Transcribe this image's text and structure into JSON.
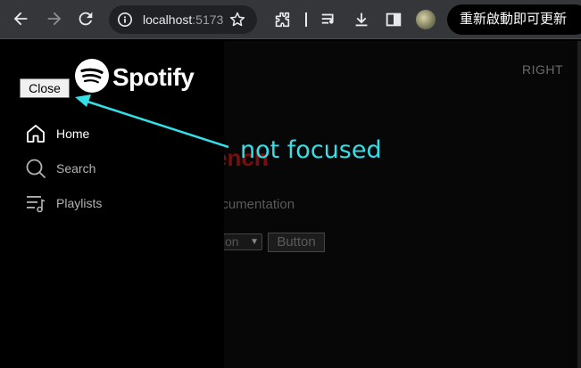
{
  "browser": {
    "url_host": "localhost",
    "url_port": ":5173",
    "update_button": "重新啟動即可更新",
    "icons": [
      "back-icon",
      "forward-icon",
      "reload-icon",
      "site-info-icon",
      "bookmark-star-icon",
      "extensions-icon",
      "media-queue-icon",
      "download-icon",
      "side-panel-icon",
      "profile-avatar-icon"
    ]
  },
  "page": {
    "right_label": "RIGHT",
    "heading_partial": "ench",
    "doc_partial": "ocumentation",
    "select_partial": "tion",
    "button_label": "Button"
  },
  "sidebar": {
    "logo_text": "Spotify",
    "close_label": "Close",
    "items": [
      {
        "label": "Home",
        "icon": "home-icon",
        "active": true
      },
      {
        "label": "Search",
        "icon": "search-icon",
        "active": false
      },
      {
        "label": "Playlists",
        "icon": "playlists-icon",
        "active": false
      }
    ]
  },
  "annotation": {
    "text": "not focused",
    "color": "#33e0e8"
  },
  "colors": {
    "accent_red": "#7a0d0d",
    "sidebar_bg": "#000000",
    "chrome_bg": "#35363a"
  }
}
